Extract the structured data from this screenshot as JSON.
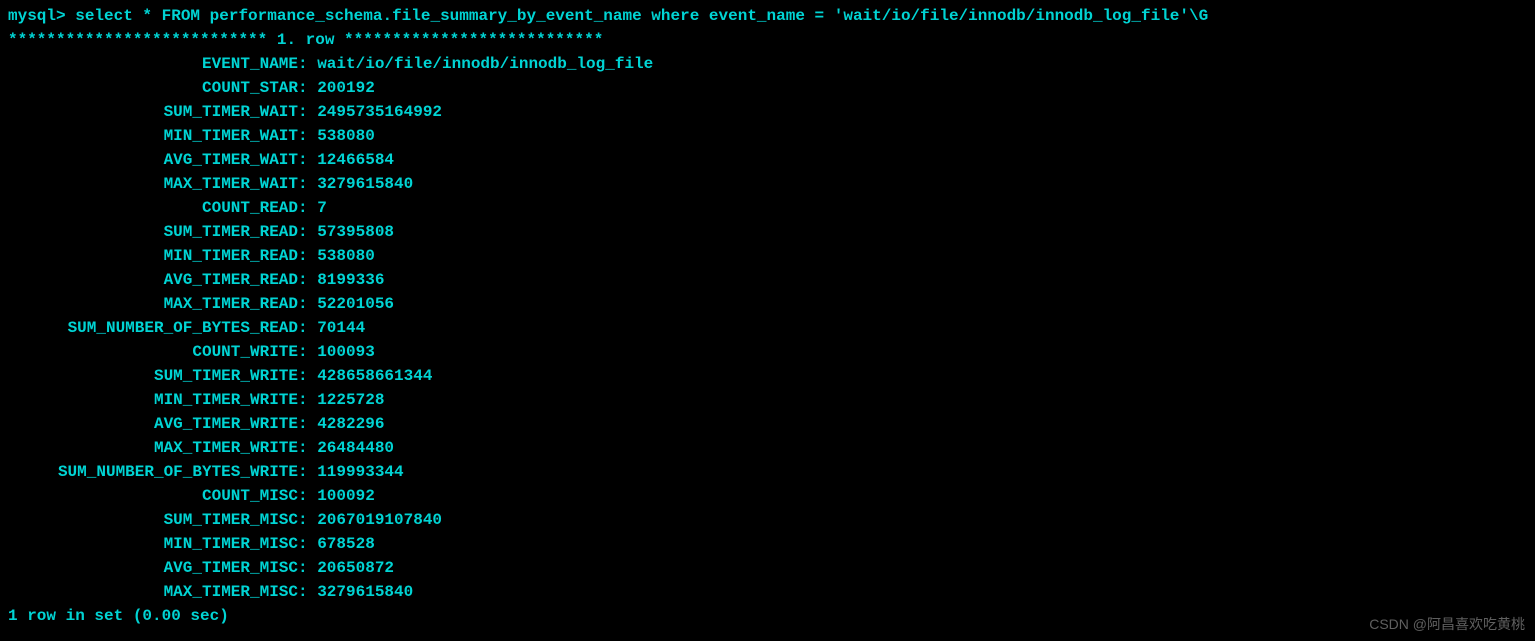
{
  "prompt_line": "mysql> select *  FROM performance_schema.file_summary_by_event_name where event_name  = 'wait/io/file/innodb/innodb_log_file'\\G",
  "row_separator": "*************************** 1. row ***************************",
  "fields": [
    {
      "label": "EVENT_NAME",
      "value": "wait/io/file/innodb/innodb_log_file"
    },
    {
      "label": "COUNT_STAR",
      "value": "200192"
    },
    {
      "label": "SUM_TIMER_WAIT",
      "value": "2495735164992"
    },
    {
      "label": "MIN_TIMER_WAIT",
      "value": "538080"
    },
    {
      "label": "AVG_TIMER_WAIT",
      "value": "12466584"
    },
    {
      "label": "MAX_TIMER_WAIT",
      "value": "3279615840"
    },
    {
      "label": "COUNT_READ",
      "value": "7"
    },
    {
      "label": "SUM_TIMER_READ",
      "value": "57395808"
    },
    {
      "label": "MIN_TIMER_READ",
      "value": "538080"
    },
    {
      "label": "AVG_TIMER_READ",
      "value": "8199336"
    },
    {
      "label": "MAX_TIMER_READ",
      "value": "52201056"
    },
    {
      "label": "SUM_NUMBER_OF_BYTES_READ",
      "value": "70144"
    },
    {
      "label": "COUNT_WRITE",
      "value": "100093"
    },
    {
      "label": "SUM_TIMER_WRITE",
      "value": "428658661344"
    },
    {
      "label": "MIN_TIMER_WRITE",
      "value": "1225728"
    },
    {
      "label": "AVG_TIMER_WRITE",
      "value": "4282296"
    },
    {
      "label": "MAX_TIMER_WRITE",
      "value": "26484480"
    },
    {
      "label": "SUM_NUMBER_OF_BYTES_WRITE",
      "value": "119993344"
    },
    {
      "label": "COUNT_MISC",
      "value": "100092"
    },
    {
      "label": "SUM_TIMER_MISC",
      "value": "2067019107840"
    },
    {
      "label": "MIN_TIMER_MISC",
      "value": "678528"
    },
    {
      "label": "AVG_TIMER_MISC",
      "value": "20650872"
    },
    {
      "label": "MAX_TIMER_MISC",
      "value": "3279615840"
    }
  ],
  "footer": "1 row in set (0.00 sec)",
  "watermark": "CSDN @阿昌喜欢吃黄桃"
}
